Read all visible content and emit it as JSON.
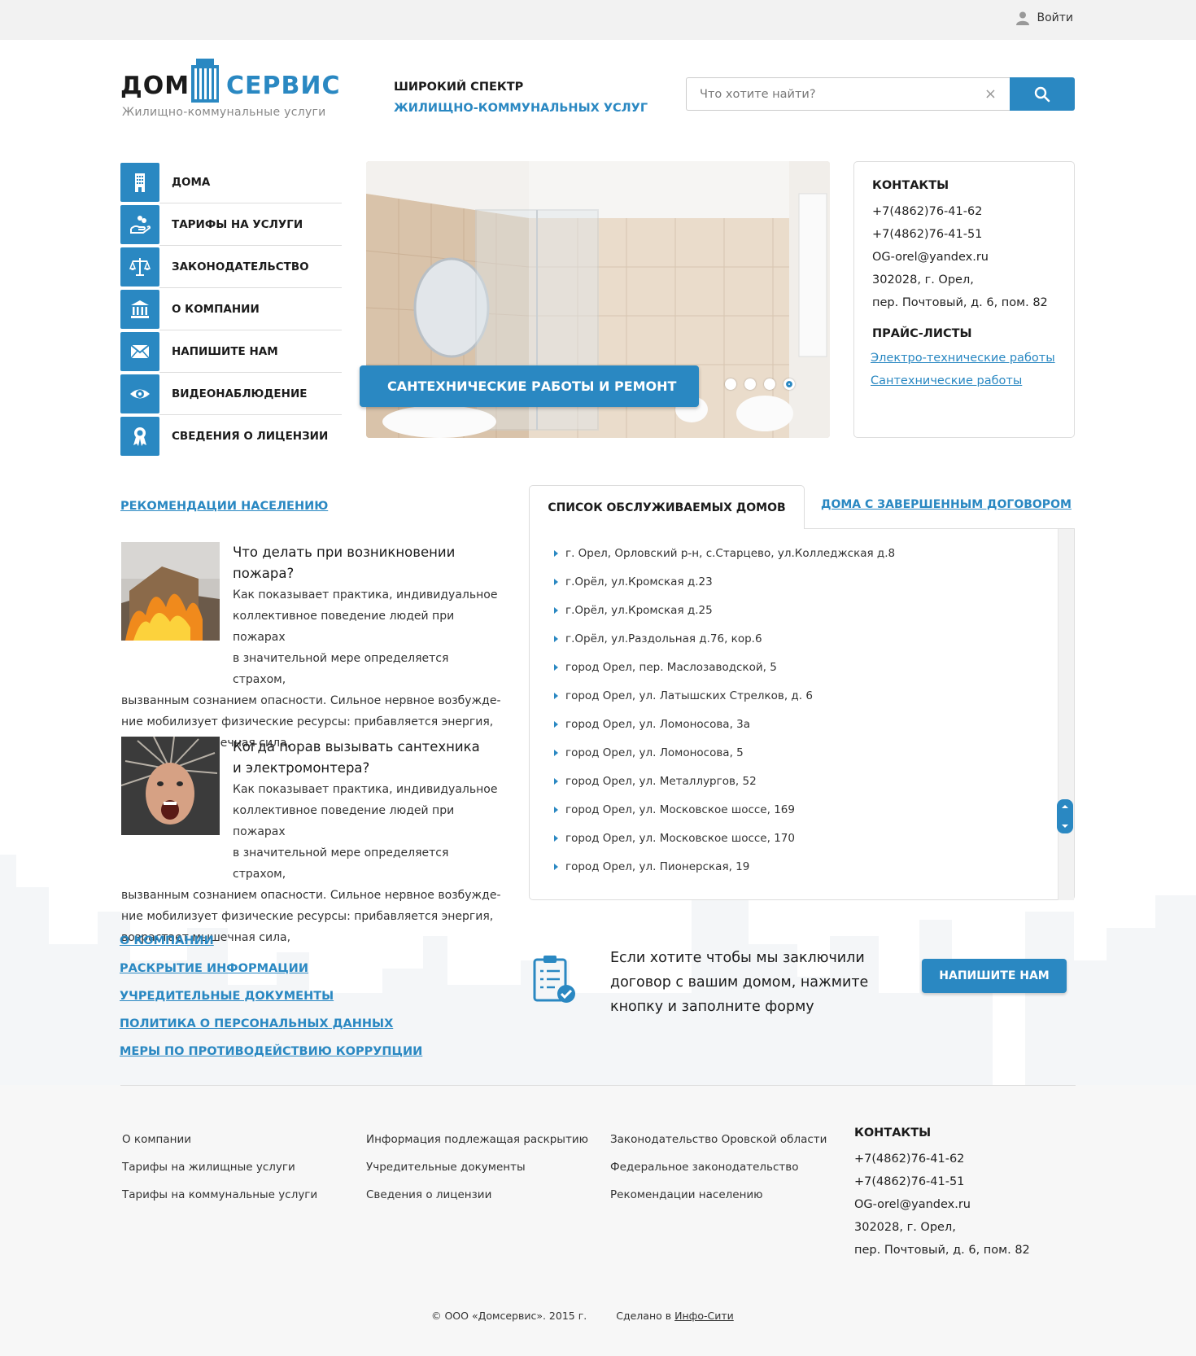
{
  "topbar": {
    "login_label": "Войти",
    "login_icon": "user-icon"
  },
  "logo": {
    "part1": "ДОМ",
    "part2": "СЕРВИС",
    "subtitle": "Жилищно-коммунальные услуги"
  },
  "tagline": {
    "line1": "ШИРОКИЙ СПЕКТР",
    "line2": "ЖИЛИЩНО-КОММУНАЛЬНЫХ УСЛУГ"
  },
  "search": {
    "placeholder": "Что хотите найти?",
    "value": ""
  },
  "side_menu": [
    {
      "label": "ДОМА",
      "icon": "building-icon"
    },
    {
      "label": "ТАРИФЫ НА УСЛУГИ",
      "icon": "coins-hand-icon"
    },
    {
      "label": "ЗАКОНОДАТЕЛЬСТВО",
      "icon": "scales-icon"
    },
    {
      "label": "О КОМПАНИИ",
      "icon": "institution-icon"
    },
    {
      "label": "НАПИШИТЕ НАМ",
      "icon": "envelope-icon"
    },
    {
      "label": "ВИДЕОНАБЛЮДЕНИЕ",
      "icon": "eye-icon"
    },
    {
      "label": "СВЕДЕНИЯ О ЛИЦЕНЗИИ",
      "icon": "award-icon"
    }
  ],
  "slider": {
    "caption": "САНТЕХНИЧЕСКИЕ РАБОТЫ И РЕМОНТ",
    "slide_count": 4,
    "active_index": 3
  },
  "contacts": {
    "title": "КОНТАКТЫ",
    "phone1": "+7(4862)76-41-62",
    "phone2": "+7(4862)76-41-51",
    "email": "OG-orel@yandex.ru",
    "address1": "302028, г. Орел,",
    "address2": "пер. Почтовый, д. 6, пом. 82",
    "price_title": "ПРАЙС-ЛИСТЫ",
    "price1": "Электро-технические работы",
    "price2": "Сантехнические работы"
  },
  "recommendations": {
    "title": "РЕКОМЕНДАЦИИ НАСЕЛЕНИЮ",
    "articles": [
      {
        "head1": "Что делать при возникновении",
        "head2": "пожара?",
        "l1": "Как показывает практика, индивидуальное",
        "l2": "коллективное поведение людей при пожарах",
        "l3": "в значительной мере определяется страхом,",
        "l4": "вызванным сознанием опасности. Сильное нервное возбужде-",
        "l5": "ние мобилизует физические ресурсы: прибавляется энергия,",
        "l6": "возрастает мышечная сила,"
      },
      {
        "head1": "Когда порав вызывать сантехника",
        "head2": "и электромонтера?",
        "l1": "Как показывает практика, индивидуальное",
        "l2": "коллективное поведение людей при пожарах",
        "l3": "в значительной мере определяется страхом,",
        "l4": "вызванным сознанием опасности. Сильное нервное возбужде-",
        "l5": "ние мобилизует физические ресурсы: прибавляется энергия,",
        "l6": "возрастает мышечная сила,"
      }
    ]
  },
  "tabs": {
    "active": "СПИСОК ОБСЛУЖИВАЕМЫХ ДОМОВ",
    "other": "ДОМА С ЗАВЕРШЕННЫМ ДОГОВОРОМ",
    "houses": [
      "г. Орел, Орловский р-н, с.Старцево, ул.Колледжская д.8",
      "г.Орёл, ул.Кромская д.23",
      "г.Орёл, ул.Кромская д.25",
      "г.Орёл, ул.Раздольная д.76, кор.6",
      "город Орел, пер. Маслозаводской, 5",
      "город Орел, ул. Латышских Стрелков, д. 6",
      "город Орел, ул. Ломоносова, 3а",
      "город Орел, ул. Ломоносова, 5",
      "город Орел, ул. Металлургов, 52",
      "город Орел, ул. Московское шоссе, 169",
      "город Орел, ул. Московское шоссе, 170",
      "город Орел, ул. Пионерская, 19"
    ]
  },
  "info_links": [
    "О КОМПАНИИ",
    "РАСКРЫТИЕ ИНФОРМАЦИИ",
    "УЧРЕДИТЕЛЬНЫЕ ДОКУМЕНТЫ",
    "ПОЛИТИКА О ПЕРСОНАЛЬНЫХ ДАННЫХ",
    "МЕРЫ ПО ПРОТИВОДЕЙСТВИЮ КОРРУПЦИИ"
  ],
  "callout": {
    "line1": "Если хотите чтобы мы заключили",
    "line2": "договор с вашим домом, нажмите",
    "line3": "кнопку и заполните форму",
    "button": "НАПИШИТЕ НАМ",
    "icon": "clipboard-check-icon"
  },
  "footer": {
    "col1": [
      "О компании",
      "Тарифы на жилищные услуги",
      "Тарифы на коммунальные услуги"
    ],
    "col2": [
      "Информация подлежащая раскрытию",
      "Учредительные документы",
      "Сведения о лицензии"
    ],
    "col3": [
      "Законодательство Оровской области",
      "Федеральное законодательство",
      "Рекомендации населению"
    ],
    "contacts_title": "КОНТАКТЫ",
    "phone1": "+7(4862)76-41-62",
    "phone2": "+7(4862)76-41-51",
    "email": "OG-orel@yandex.ru",
    "address1": "302028, г. Орел,",
    "address2": "пер. Почтовый, д. 6, пом. 82",
    "copyright": "© ООО «Домсервис». 2015 г.",
    "made_prefix": "Сделано в",
    "made_link": "Инфо-Сити"
  },
  "colors": {
    "accent": "#2a88c2",
    "text": "#1b1b1b",
    "topbar": "#f2f2f2",
    "footer": "#f7f7f7"
  }
}
